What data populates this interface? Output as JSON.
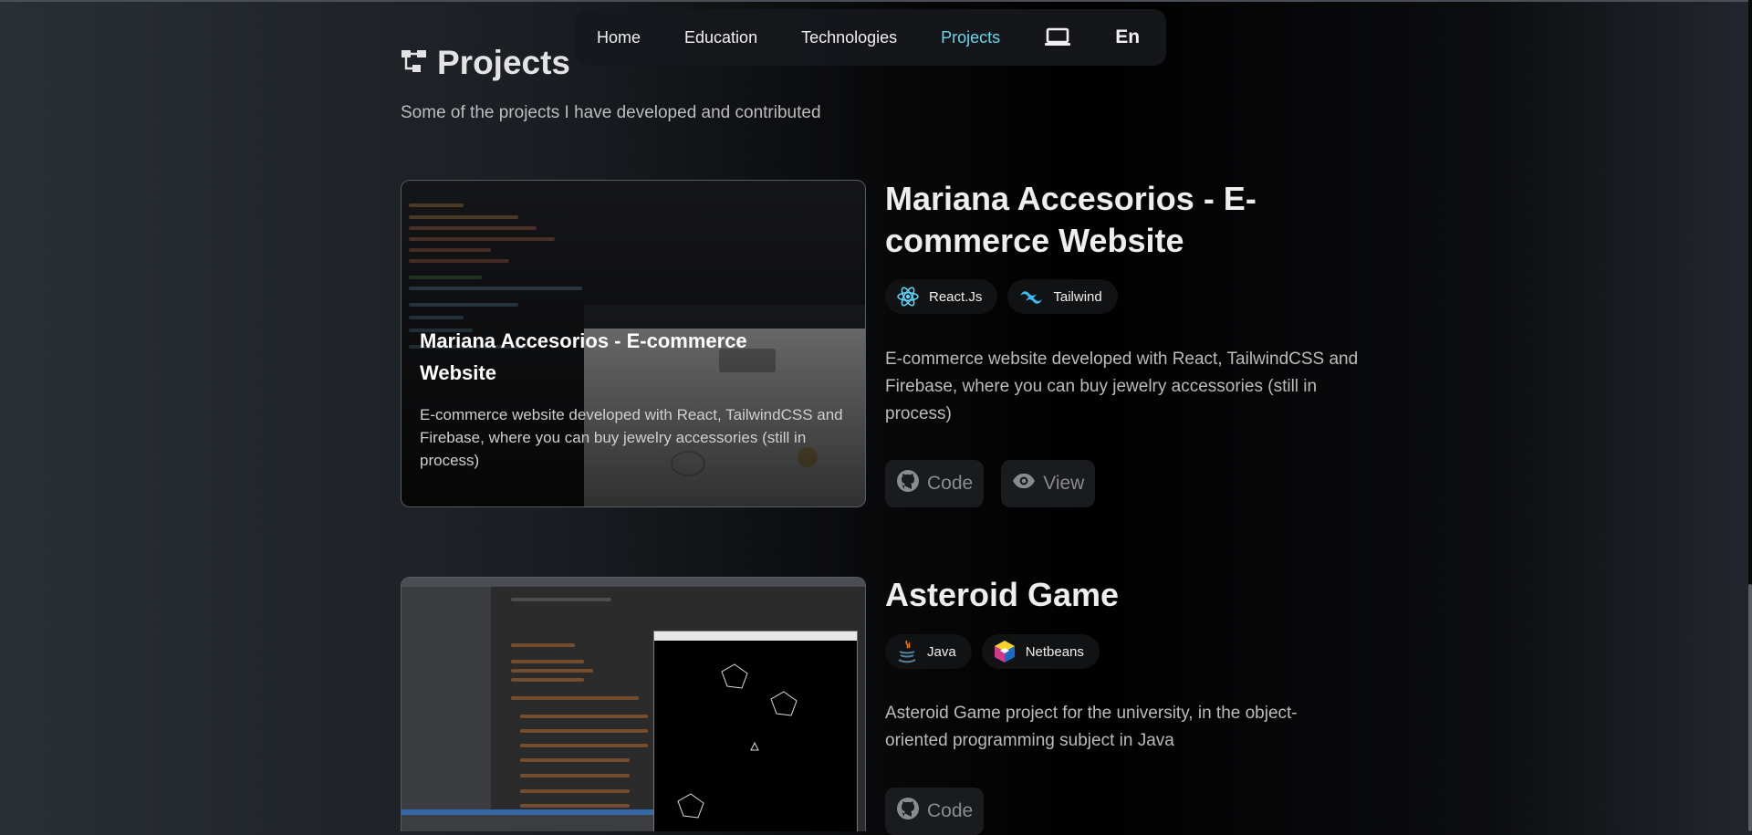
{
  "nav": {
    "links": [
      {
        "label": "Home"
      },
      {
        "label": "Education"
      },
      {
        "label": "Technologies"
      },
      {
        "label": "Projects",
        "active": true
      }
    ],
    "device_icon": "laptop-icon",
    "language": "En",
    "active_color": "#67d7ee"
  },
  "section": {
    "icon": "project-tree-icon",
    "title": "Projects",
    "subtitle": "Some of the projects I have developed and contributed"
  },
  "projects": [
    {
      "title": "Mariana Accesorios - E-commerce Website",
      "card_title": "Mariana Accesorios - E-commerce Website",
      "card_description": "E-commerce website developed with React, TailwindCSS and Firebase, where you can buy jewelry accessories (still in process)",
      "tags": [
        {
          "label": "React.Js",
          "icon": "react-icon"
        },
        {
          "label": "Tailwind",
          "icon": "tailwind-icon"
        }
      ],
      "description": "E-commerce website developed with React, TailwindCSS and Firebase, where you can buy jewelry accessories (still in process)",
      "buttons": [
        {
          "label": "Code",
          "icon": "github-icon"
        },
        {
          "label": "View",
          "icon": "eye-icon"
        }
      ]
    },
    {
      "title": "Asteroid Game",
      "tags": [
        {
          "label": "Java",
          "icon": "java-icon"
        },
        {
          "label": "Netbeans",
          "icon": "netbeans-icon"
        }
      ],
      "description": "Asteroid Game project for the university, in the object-oriented programming subject in Java",
      "buttons": [
        {
          "label": "Code",
          "icon": "github-icon"
        }
      ]
    }
  ]
}
